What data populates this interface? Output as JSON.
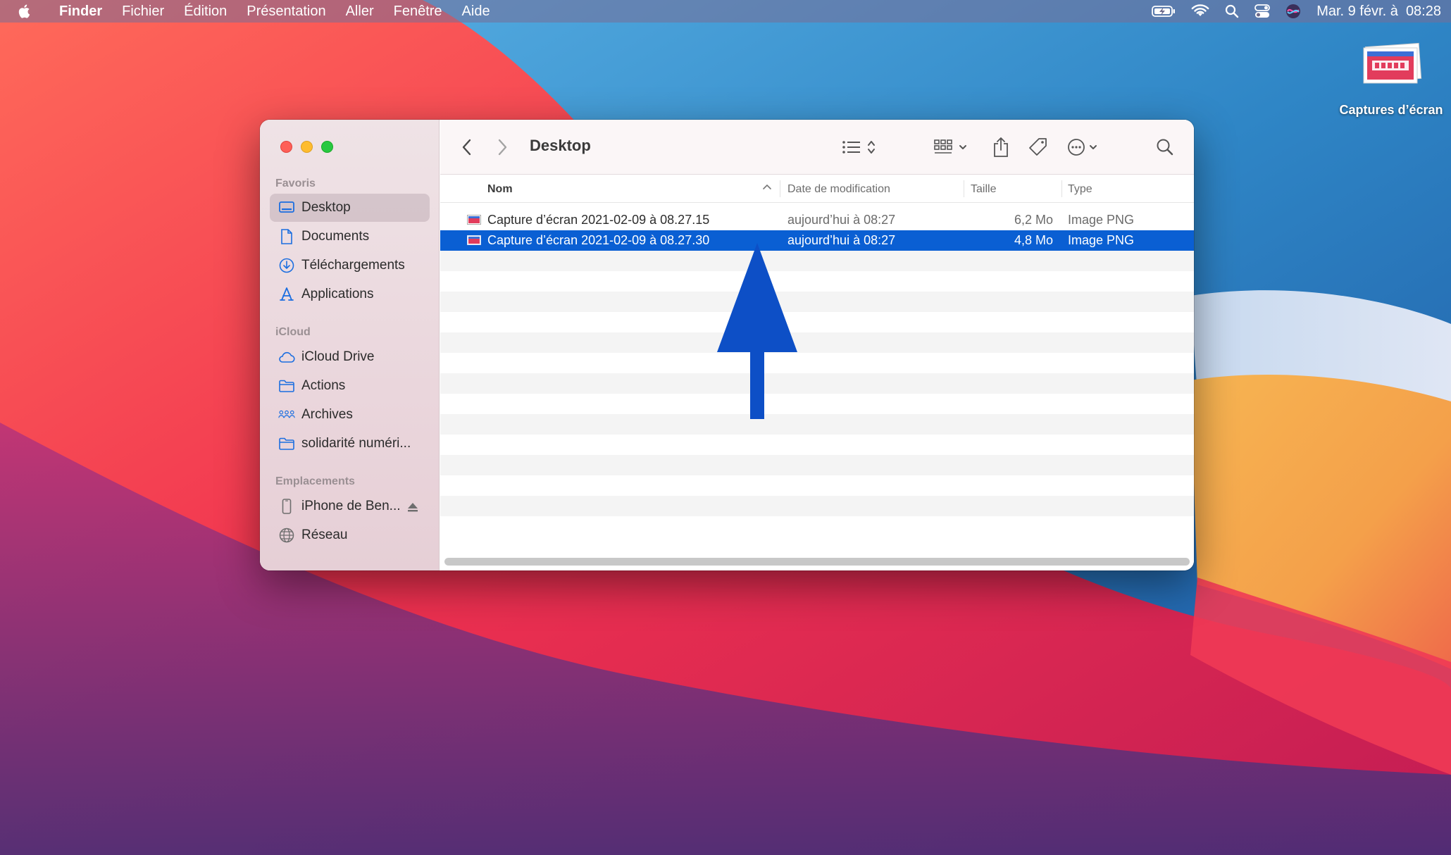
{
  "menubar": {
    "app_name": "Finder",
    "menus": [
      "Fichier",
      "Édition",
      "Présentation",
      "Aller",
      "Fenêtre",
      "Aide"
    ],
    "clock": "Mar. 9 févr. à  08:28",
    "icons": [
      "apple-icon",
      "battery-charging-icon",
      "wifi-icon",
      "spotlight-search-icon",
      "control-center-icon",
      "siri-icon"
    ]
  },
  "desktop": {
    "icon_label": "Captures d’écran"
  },
  "window": {
    "title": "Desktop",
    "sidebar": {
      "sections": [
        {
          "title": "Favoris",
          "items": [
            {
              "label": "Desktop",
              "icon": "desktop-icon",
              "active": true
            },
            {
              "label": "Documents",
              "icon": "document-icon"
            },
            {
              "label": "Téléchargements",
              "icon": "download-icon"
            },
            {
              "label": "Applications",
              "icon": "applications-icon"
            }
          ]
        },
        {
          "title": "iCloud",
          "items": [
            {
              "label": "iCloud Drive",
              "icon": "cloud-icon"
            },
            {
              "label": "Actions",
              "icon": "folder-icon"
            },
            {
              "label": "Archives",
              "icon": "shared-folder-icon"
            },
            {
              "label": "solidarité numéri...",
              "icon": "folder-icon"
            }
          ]
        },
        {
          "title": "Emplacements",
          "items": [
            {
              "label": "iPhone de Ben...",
              "icon": "iphone-icon"
            },
            {
              "label": "Réseau",
              "icon": "network-icon"
            }
          ]
        }
      ]
    },
    "columns": {
      "name": "Nom",
      "date": "Date de modification",
      "size": "Taille",
      "type": "Type"
    },
    "files": [
      {
        "name": "Capture d’écran 2021-02-09 à 08.27.15",
        "date": "aujourd’hui à 08:27",
        "size": "6,2 Mo",
        "type": "Image PNG",
        "selected": false
      },
      {
        "name": "Capture d’écran 2021-02-09 à 08.27.30",
        "date": "aujourd’hui à 08:27",
        "size": "4,8 Mo",
        "type": "Image PNG",
        "selected": true
      }
    ]
  },
  "colors": {
    "selection": "#0a5fd3",
    "arrow": "#0d4fc6"
  }
}
